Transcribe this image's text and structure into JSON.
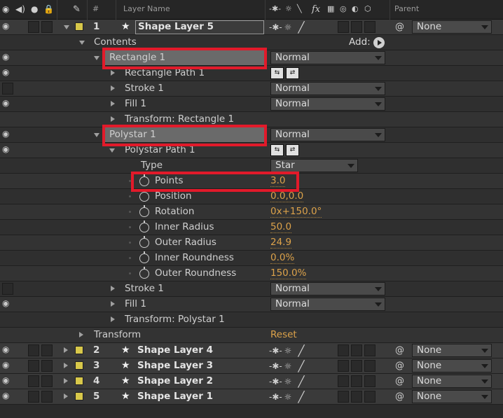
{
  "header": {
    "col_num": "#",
    "col_layer_name": "Layer Name",
    "col_parent": "Parent",
    "switch_icons": "fx"
  },
  "layer1": {
    "number": "1",
    "name": "Shape Layer 5",
    "parent": "None"
  },
  "contents": {
    "label": "Contents",
    "add_label": "Add:"
  },
  "rectangle": {
    "label": "Rectangle 1",
    "mode": "Normal",
    "path_label": "Rectangle Path 1",
    "stroke_label": "Stroke 1",
    "stroke_mode": "Normal",
    "fill_label": "Fill 1",
    "fill_mode": "Normal",
    "transform_label": "Transform: Rectangle 1"
  },
  "polystar": {
    "label": "Polystar 1",
    "mode": "Normal",
    "path_label": "Polystar Path 1",
    "type_label": "Type",
    "type_value": "Star",
    "points_label": "Points",
    "points_value": "3.0",
    "position_label": "Position",
    "position_value": "0.0,0.0",
    "rotation_label": "Rotation",
    "rotation_value": "0x+150.0°",
    "inner_radius_label": "Inner Radius",
    "inner_radius_value": "50.0",
    "outer_radius_label": "Outer Radius",
    "outer_radius_value": "24.9",
    "inner_roundness_label": "Inner Roundness",
    "inner_roundness_value": "0.0%",
    "outer_roundness_label": "Outer Roundness",
    "outer_roundness_value": "150.0%",
    "stroke_label": "Stroke 1",
    "stroke_mode": "Normal",
    "fill_label": "Fill 1",
    "fill_mode": "Normal",
    "transform_label": "Transform: Polystar 1"
  },
  "layer_transform": {
    "label": "Transform",
    "reset_label": "Reset"
  },
  "other_layers": [
    {
      "number": "2",
      "name": "Shape Layer 4",
      "parent": "None"
    },
    {
      "number": "3",
      "name": "Shape Layer 3",
      "parent": "None"
    },
    {
      "number": "4",
      "name": "Shape Layer 2",
      "parent": "None"
    },
    {
      "number": "5",
      "name": "Shape Layer 1",
      "parent": "None"
    }
  ],
  "colors": {
    "label_swatch": "#d8c84a",
    "value_orange": "#dca24a",
    "highlight_red": "#e21a2a"
  },
  "icons": [
    "eye-icon",
    "audio-icon",
    "solo-icon",
    "lock-icon",
    "label-tag-icon",
    "star-icon",
    "stopwatch-icon",
    "sun-icon",
    "pen-icon",
    "pickwhip-icon",
    "merge-paths-icon"
  ]
}
